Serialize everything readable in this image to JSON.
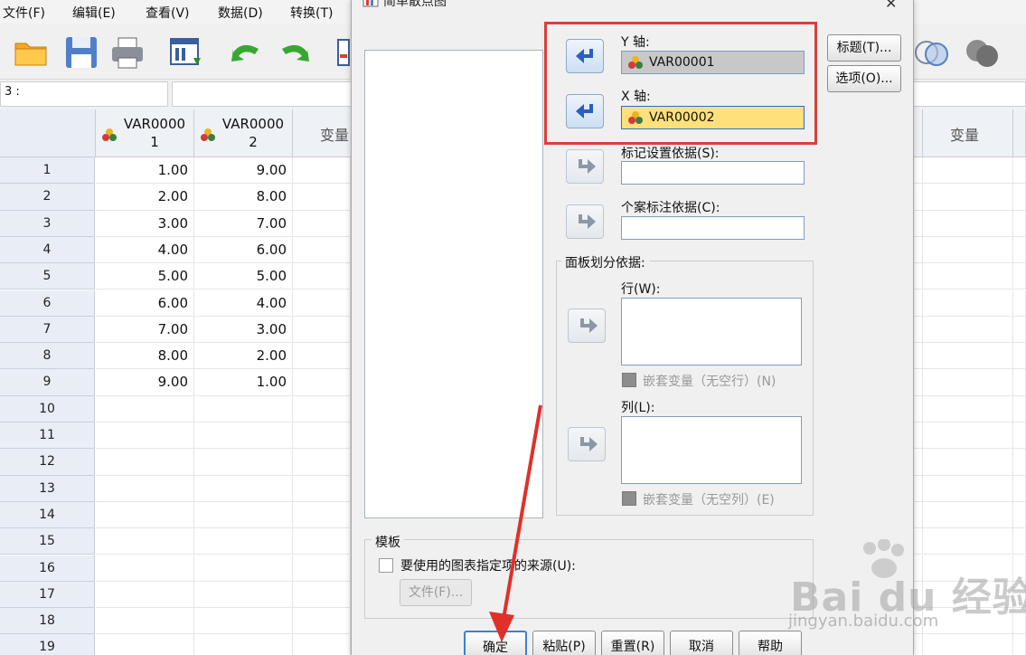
{
  "menu": [
    "文件(F)",
    "编辑(E)",
    "查看(V)",
    "数据(D)",
    "转换(T)"
  ],
  "cell_ref": "3 :",
  "grid": {
    "columns": [
      "VAR0000 1",
      "VAR0000 2",
      "变量",
      "变量"
    ],
    "col1_line1": "VAR0000",
    "col1_line2": "1",
    "col2_line1": "VAR0000",
    "col2_line2": "2",
    "col3": "变量",
    "col_right": "变量",
    "rows": [
      "1",
      "2",
      "3",
      "4",
      "5",
      "6",
      "7",
      "8",
      "9",
      "10",
      "11",
      "12",
      "13",
      "14",
      "15",
      "16",
      "17",
      "18",
      "19"
    ],
    "var1": [
      "1.00",
      "2.00",
      "3.00",
      "4.00",
      "5.00",
      "6.00",
      "7.00",
      "8.00",
      "9.00"
    ],
    "var2": [
      "9.00",
      "8.00",
      "7.00",
      "6.00",
      "5.00",
      "4.00",
      "3.00",
      "2.00",
      "1.00"
    ]
  },
  "dialog": {
    "title": "简单散点图",
    "y_axis_label": "Y 轴:",
    "y_axis_value": "VAR00001",
    "x_axis_label": "X 轴:",
    "x_axis_value": "VAR00002",
    "marker_label": "标记设置依据(S):",
    "case_label": "个案标注依据(C):",
    "panel_group": "面板划分依据:",
    "rows_label": "行(W):",
    "rows_nest": "嵌套变量（无空行）(N)",
    "cols_label": "列(L):",
    "cols_nest": "嵌套变量（无空列）(E)",
    "template_group": "模板",
    "template_check": "要使用的图表指定项的来源(U):",
    "file_button": "文件(F)...",
    "title_button": "标题(T)...",
    "options_button": "选项(O)...",
    "ok": "确定",
    "paste": "粘贴(P)",
    "reset": "重置(R)",
    "cancel": "取消",
    "help": "帮助"
  },
  "watermark": {
    "text": "Bai du 经验",
    "url": "jingyan.baidu.com"
  },
  "colors": {
    "highlight": "#d9403a",
    "x_field": "#ffe07a",
    "y_field": "#c8c8c8",
    "arrow": "#e0302a"
  }
}
